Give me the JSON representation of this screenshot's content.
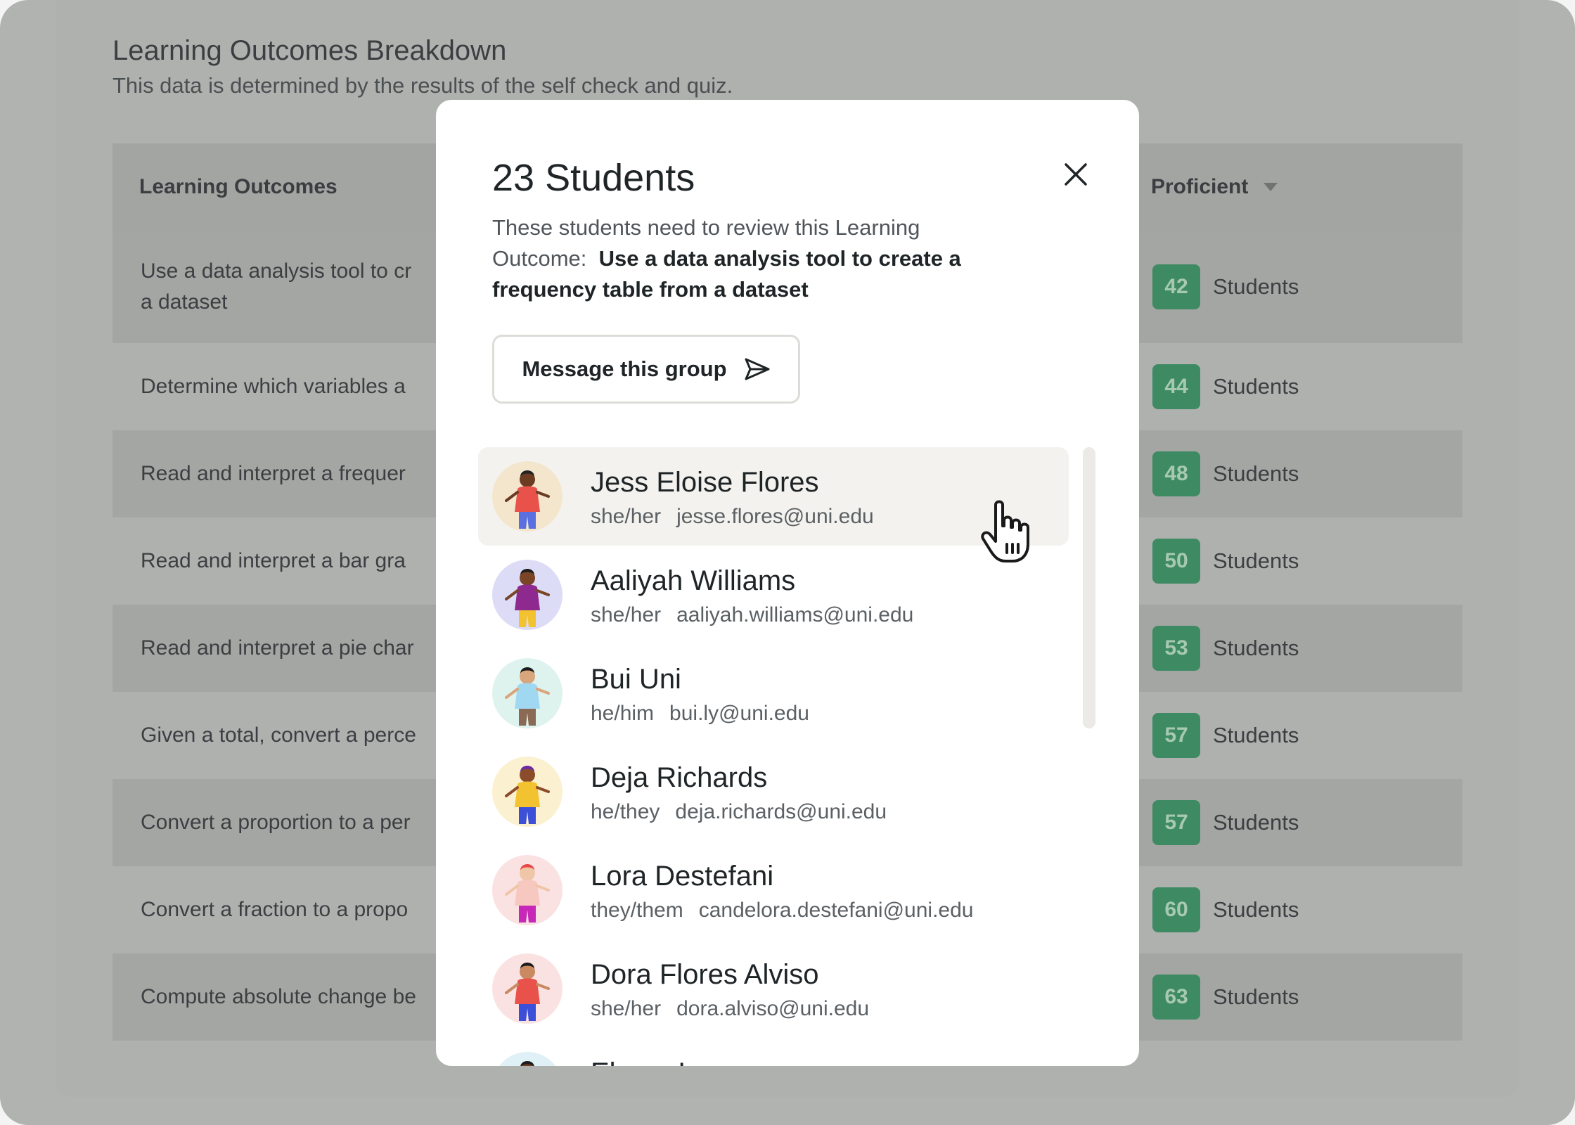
{
  "page": {
    "title": "Learning Outcomes Breakdown",
    "subtitle": "This data is determined by the results of the self check and quiz."
  },
  "table": {
    "col_outcomes": "Learning Outcomes",
    "col_proficient": "Proficient",
    "rows": [
      {
        "outcome_1": "Use a data analysis tool to cr",
        "outcome_2": "a dataset",
        "count": "42",
        "unit": "Students"
      },
      {
        "outcome_1": "Determine which variables a",
        "count": "44",
        "unit": "Students"
      },
      {
        "outcome_1": "Read and interpret a frequer",
        "count": "48",
        "unit": "Students"
      },
      {
        "outcome_1": "Read and interpret a bar gra",
        "count": "50",
        "unit": "Students"
      },
      {
        "outcome_1": "Read and interpret a pie char",
        "count": "53",
        "unit": "Students"
      },
      {
        "outcome_1": "Given a total, convert a perce",
        "count": "57",
        "unit": "Students"
      },
      {
        "outcome_1": "Convert a proportion to a per",
        "count": "57",
        "unit": "Students"
      },
      {
        "outcome_1": "Convert a fraction to a propo",
        "count": "60",
        "unit": "Students"
      },
      {
        "outcome_1": "Compute absolute change be",
        "count": "63",
        "unit": "Students"
      }
    ]
  },
  "modal": {
    "title": "23 Students",
    "desc_prefix": "These students need to review this Learning Outcome:",
    "desc_outcome": "Use a data analysis tool to create a frequency table from a dataset",
    "message_button": "Message this group",
    "close_icon": "close-icon",
    "students": [
      {
        "name": "Jess Eloise Flores",
        "pronouns": "she/her",
        "email": "jesse.flores@uni.edu",
        "bg": "#f4e6cc",
        "shirt": "#e8524a",
        "pants": "#5a6fe0",
        "skin": "#6b3b22",
        "hair": "#222222"
      },
      {
        "name": "Aaliyah Williams",
        "pronouns": "she/her",
        "email": "aaliyah.williams@uni.edu",
        "bg": "#dcdcf7",
        "shirt": "#8e2a8f",
        "pants": "#f2c230",
        "skin": "#7a4426",
        "hair": "#1c1c1c"
      },
      {
        "name": "Bui Uni",
        "pronouns": "he/him",
        "email": "bui.ly@uni.edu",
        "bg": "#dff3ee",
        "shirt": "#9fd8f0",
        "pants": "#8a6a55",
        "skin": "#d9a57c",
        "hair": "#1c1c1c"
      },
      {
        "name": "Deja Richards",
        "pronouns": "he/they",
        "email": "deja.richards@uni.edu",
        "bg": "#fbf0cf",
        "shirt": "#f2c230",
        "pants": "#3b4fd8",
        "skin": "#8a4c2a",
        "hair": "#6a2aa8"
      },
      {
        "name": "Lora Destefani",
        "pronouns": "they/them",
        "email": "candelora.destefani@uni.edu",
        "bg": "#fbe2e2",
        "shirt": "#f6c8c0",
        "pants": "#c828b8",
        "skin": "#f0c6a8",
        "hair": "#e84a4a"
      },
      {
        "name": "Dora Flores Alviso",
        "pronouns": "she/her",
        "email": "dora.alviso@uni.edu",
        "bg": "#fbe2e2",
        "shirt": "#e8524a",
        "pants": "#3b4fd8",
        "skin": "#c98a62",
        "hair": "#1c1c1c"
      },
      {
        "name": "Ebony Lee",
        "pronouns": "",
        "email": "",
        "bg": "#dff0f7",
        "shirt": "#6fb7e0",
        "pants": "#3b4fd8",
        "skin": "#6b3b22",
        "hair": "#1c1c1c"
      }
    ]
  },
  "icons": {
    "send": "send-icon",
    "cursor": "hand-cursor-icon",
    "sort": "sort-caret-icon"
  }
}
